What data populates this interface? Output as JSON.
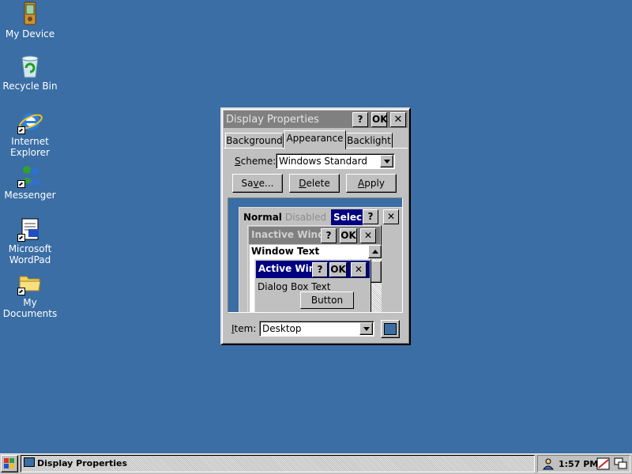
{
  "desktop": {
    "icons": [
      {
        "label": "My Device"
      },
      {
        "label": "Recycle Bin"
      },
      {
        "label": "Internet\nExplorer"
      },
      {
        "label": "Messenger"
      },
      {
        "label": "Microsoft\nWordPad"
      },
      {
        "label": "My\nDocuments"
      }
    ]
  },
  "dialog": {
    "title": "Display Properties",
    "help_button": "?",
    "ok_button": "OK",
    "close_button": "✕",
    "tabs": [
      "Background",
      "Appearance",
      "Backlight"
    ],
    "active_tab": "Appearance",
    "scheme_label_first": "S",
    "scheme_label_rest": "cheme:",
    "scheme_value": "Windows Standard",
    "save_first": "Sa",
    "save_u": "v",
    "save_rest": "e...",
    "delete_first": "",
    "delete_u": "D",
    "delete_rest": "elete",
    "apply_first": "",
    "apply_u": "A",
    "apply_rest": "pply",
    "preview": {
      "menu_normal": "Normal",
      "menu_disabled": "Disabled",
      "menu_selected": "Selec",
      "inactive_window": "Inactive Wind",
      "window_text": "Window Text",
      "active_window": "Active Win",
      "dialog_text": "Dialog Box Text",
      "button": "Button",
      "help": "?",
      "ok": "OK",
      "close": "✕"
    },
    "item_label_first": "I",
    "item_label_rest": "tem:",
    "item_value": "Desktop",
    "item_color": "#3a6ea5"
  },
  "taskbar": {
    "task_label": "Display Properties",
    "clock": "1:57 PM"
  },
  "colors": {
    "desktop": "#3a6ea5",
    "active_title": "#000080",
    "inactive_title": "#808080"
  }
}
